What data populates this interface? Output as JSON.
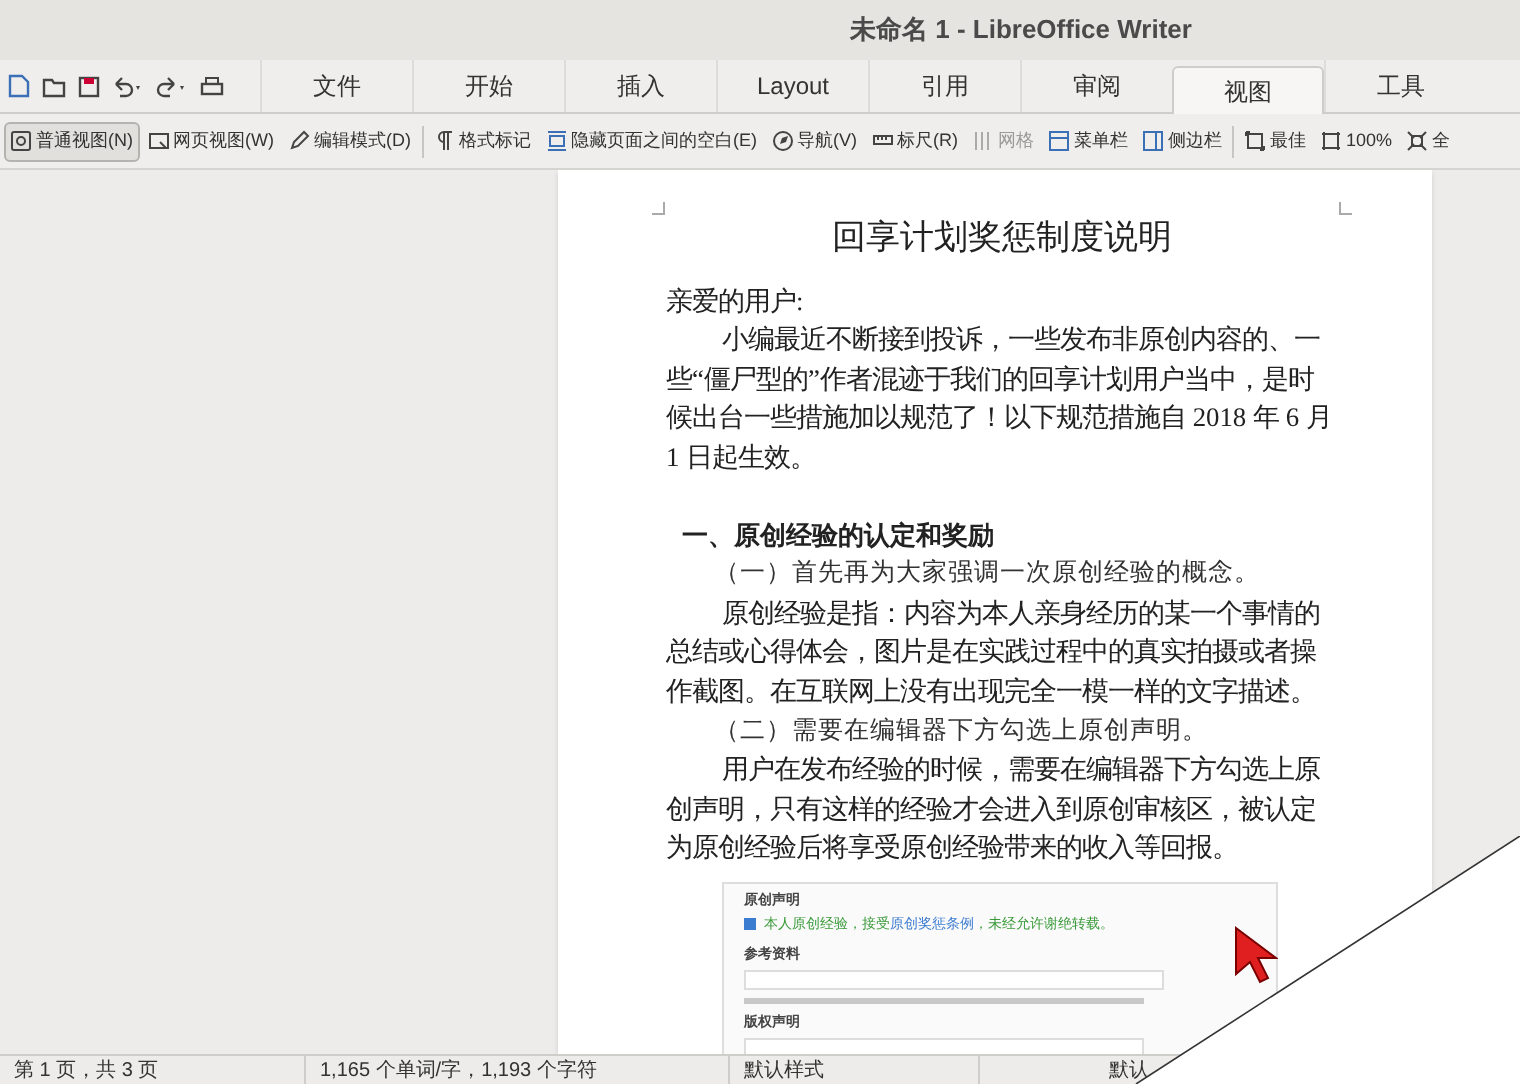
{
  "window": {
    "title": "未命名 1 - LibreOffice Writer"
  },
  "tabs": [
    {
      "label": "文件",
      "selected": false
    },
    {
      "label": "开始",
      "selected": false
    },
    {
      "label": "插入",
      "selected": false
    },
    {
      "label": "Layout",
      "selected": false
    },
    {
      "label": "引用",
      "selected": false
    },
    {
      "label": "审阅",
      "selected": false
    },
    {
      "label": "视图",
      "selected": true
    },
    {
      "label": "工具",
      "selected": false
    }
  ],
  "view_toolbar": [
    {
      "label": "普通视图(N)",
      "selected": true,
      "disabled": false
    },
    {
      "label": "网页视图(W)",
      "selected": false,
      "disabled": false
    },
    {
      "label": "编辑模式(D)",
      "selected": false,
      "disabled": false
    },
    {
      "label": "格式标记",
      "selected": false,
      "disabled": false
    },
    {
      "label": "隐藏页面之间的空白(E)",
      "selected": false,
      "disabled": false
    },
    {
      "label": "导航(V)",
      "selected": false,
      "disabled": false
    },
    {
      "label": "标尺(R)",
      "selected": false,
      "disabled": false
    },
    {
      "label": "网格",
      "selected": false,
      "disabled": true
    },
    {
      "label": "菜单栏",
      "selected": false,
      "disabled": false
    },
    {
      "label": "侧边栏",
      "selected": false,
      "disabled": false
    },
    {
      "label": "最佳",
      "selected": false,
      "disabled": false
    },
    {
      "label": "100%",
      "selected": false,
      "disabled": false
    },
    {
      "label": "全",
      "selected": false,
      "disabled": false
    }
  ],
  "document": {
    "title": "回享计划奖惩制度说明",
    "paragraphs": [
      {
        "kind": "plain",
        "text": "亲爱的用户:"
      },
      {
        "kind": "indent",
        "text": "小编最近不断接到投诉，一些发布非原创内容的、一些“僵尸型的”作者混迹于我们的回享计划用户当中，是时候出台一些措施加以规范了！以下规范措施自 2018 年 6 月 1 日起生效。"
      },
      {
        "kind": "heading",
        "text": "一、原创经验的认定和奖励"
      },
      {
        "kind": "subheading",
        "text": "（一）首先再为大家强调一次原创经验的概念。"
      },
      {
        "kind": "indent",
        "text": "原创经验是指：内容为本人亲身经历的某一个事情的总结或心得体会，图片是在实践过程中的真实拍摄或者操作截图。在互联网上没有出现完全一模一样的文字描述。"
      },
      {
        "kind": "subheading",
        "text": "（二）需要在编辑器下方勾选上原创声明。"
      },
      {
        "kind": "indent",
        "text": "用户在发布经验的时候，需要在编辑器下方勾选上原创声明，只有这样的经验才会进入到原创审核区，被认定为原创经验后将享受原创经验带来的收入等回报。"
      }
    ],
    "screenshot": {
      "heading": "原创声明",
      "checkbox": {
        "checked": true,
        "before": "本人原创经验，接受",
        "link": "原创奖惩条例",
        "after": "，未经允许谢绝转载。"
      },
      "reference_label": "参考资料",
      "copyright_label": "版权声明"
    }
  },
  "status_bar": [
    "第 1 页，共 3 页",
    "1,165 个单词/字，1,193 个字符",
    "默认样式",
    "默认"
  ]
}
